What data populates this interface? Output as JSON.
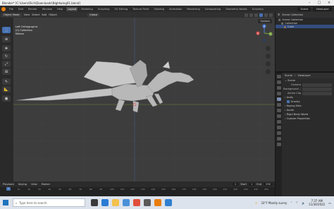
{
  "window": {
    "title": "Blender* [C:\\Users\\Rich\\Downloads\\Nightwing01.blend]"
  },
  "workspaces": [
    "File",
    "Edit",
    "Render",
    "Window",
    "Help",
    "Layout",
    "Modeling",
    "Sculpting",
    "UV Editing",
    "Texture Paint",
    "Shading",
    "Animation",
    "Rendering",
    "Compositing",
    "Geometry Nodes",
    "Scripting"
  ],
  "topbar": {
    "scene_label": "Scene",
    "viewlayer_label": "ViewLayer"
  },
  "viewport_header": {
    "mode": "Object Mode",
    "menus": [
      "View",
      "Select",
      "Add",
      "Object"
    ],
    "transform": "Global"
  },
  "viewport": {
    "info_line1": "Left Orthographic",
    "info_line2": "(0) Collection",
    "info_line3": "Meters",
    "options_label": "Options",
    "axis_labels": {
      "x": "X",
      "y": "Y",
      "z": "Z"
    }
  },
  "timeline": {
    "menus": [
      "Playback",
      "Keying",
      "View",
      "Marker"
    ],
    "start_label": "Start",
    "start": "1",
    "end_label": "End",
    "end": "250",
    "current_frame": "1",
    "ticks": [
      "0",
      "10",
      "20",
      "30",
      "40",
      "50",
      "60",
      "70",
      "80",
      "90",
      "100",
      "110",
      "120",
      "130",
      "140",
      "150",
      "160",
      "170",
      "180",
      "190",
      "200",
      "210",
      "220",
      "230",
      "240",
      "250"
    ]
  },
  "outliner": {
    "title": "Scene Collection",
    "rows": [
      "Scene Collection",
      "Collection",
      "Cube"
    ]
  },
  "properties": {
    "crumb_scene": "Scene",
    "crumb_viewlayer": "ViewLayer",
    "section_scene": "Scene",
    "camera_label": "Camera",
    "background_label": "Background...",
    "active_clip_label": "Active Clip",
    "units": "Units",
    "gravity": "Gravity",
    "keying_sets": "Keying Sets",
    "audio": "Audio",
    "rigid_body": "Rigid Body World",
    "custom_props": "Custom Properties"
  },
  "taskbar": {
    "search_placeholder": "Type here to search",
    "weather": "33°F  Mostly sunny",
    "time": "7:37 AM",
    "date": "11/30/2022"
  },
  "colors": {
    "accent": "#4772b3",
    "orange": "#e87d0d",
    "viewport_bg": "#3d3d3d"
  }
}
